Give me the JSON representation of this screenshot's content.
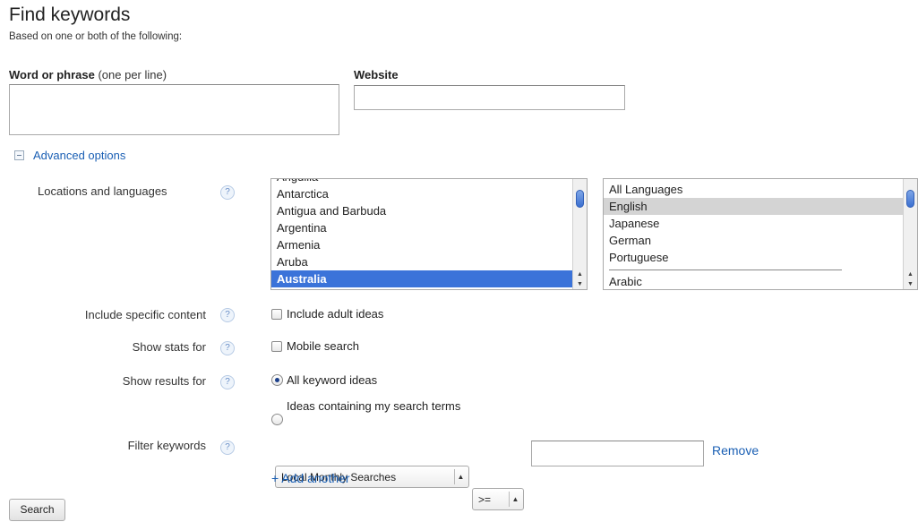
{
  "header": {
    "title": "Find keywords",
    "subtitle": "Based on one or both of the following:"
  },
  "word_field": {
    "label": "Word or phrase",
    "hint": "(one per line)",
    "value": ""
  },
  "website_field": {
    "label": "Website",
    "value": ""
  },
  "advanced": {
    "toggle_label": "Advanced options",
    "toggle_icon": "minus-box-icon"
  },
  "locations_languages": {
    "label": "Locations and languages",
    "locations": [
      "Anguilla",
      "Antarctica",
      "Antigua and Barbuda",
      "Argentina",
      "Armenia",
      "Aruba",
      "Australia"
    ],
    "selected_location": "Australia",
    "languages": [
      "All Languages",
      "English",
      "Japanese",
      "German",
      "Portuguese",
      "Arabic"
    ],
    "selected_language": "English"
  },
  "specific_content": {
    "label": "Include specific content",
    "option": "Include adult ideas",
    "checked": false
  },
  "show_stats": {
    "label": "Show stats for",
    "option": "Mobile search",
    "checked": false
  },
  "show_results": {
    "label": "Show results for",
    "options": [
      "All keyword ideas",
      "Ideas containing my search terms"
    ],
    "selected": "All keyword ideas"
  },
  "filter": {
    "label": "Filter keywords",
    "metric": "Local Monthly Searches",
    "operator": ">=",
    "value": "",
    "remove_label": "Remove",
    "add_label": "+ Add another"
  },
  "help_glyph": "?",
  "search_button": "Search",
  "colors": {
    "link": "#1a5fb4",
    "selected_location_bg": "#3b73d9",
    "selected_language_bg": "#d4d4d4"
  }
}
